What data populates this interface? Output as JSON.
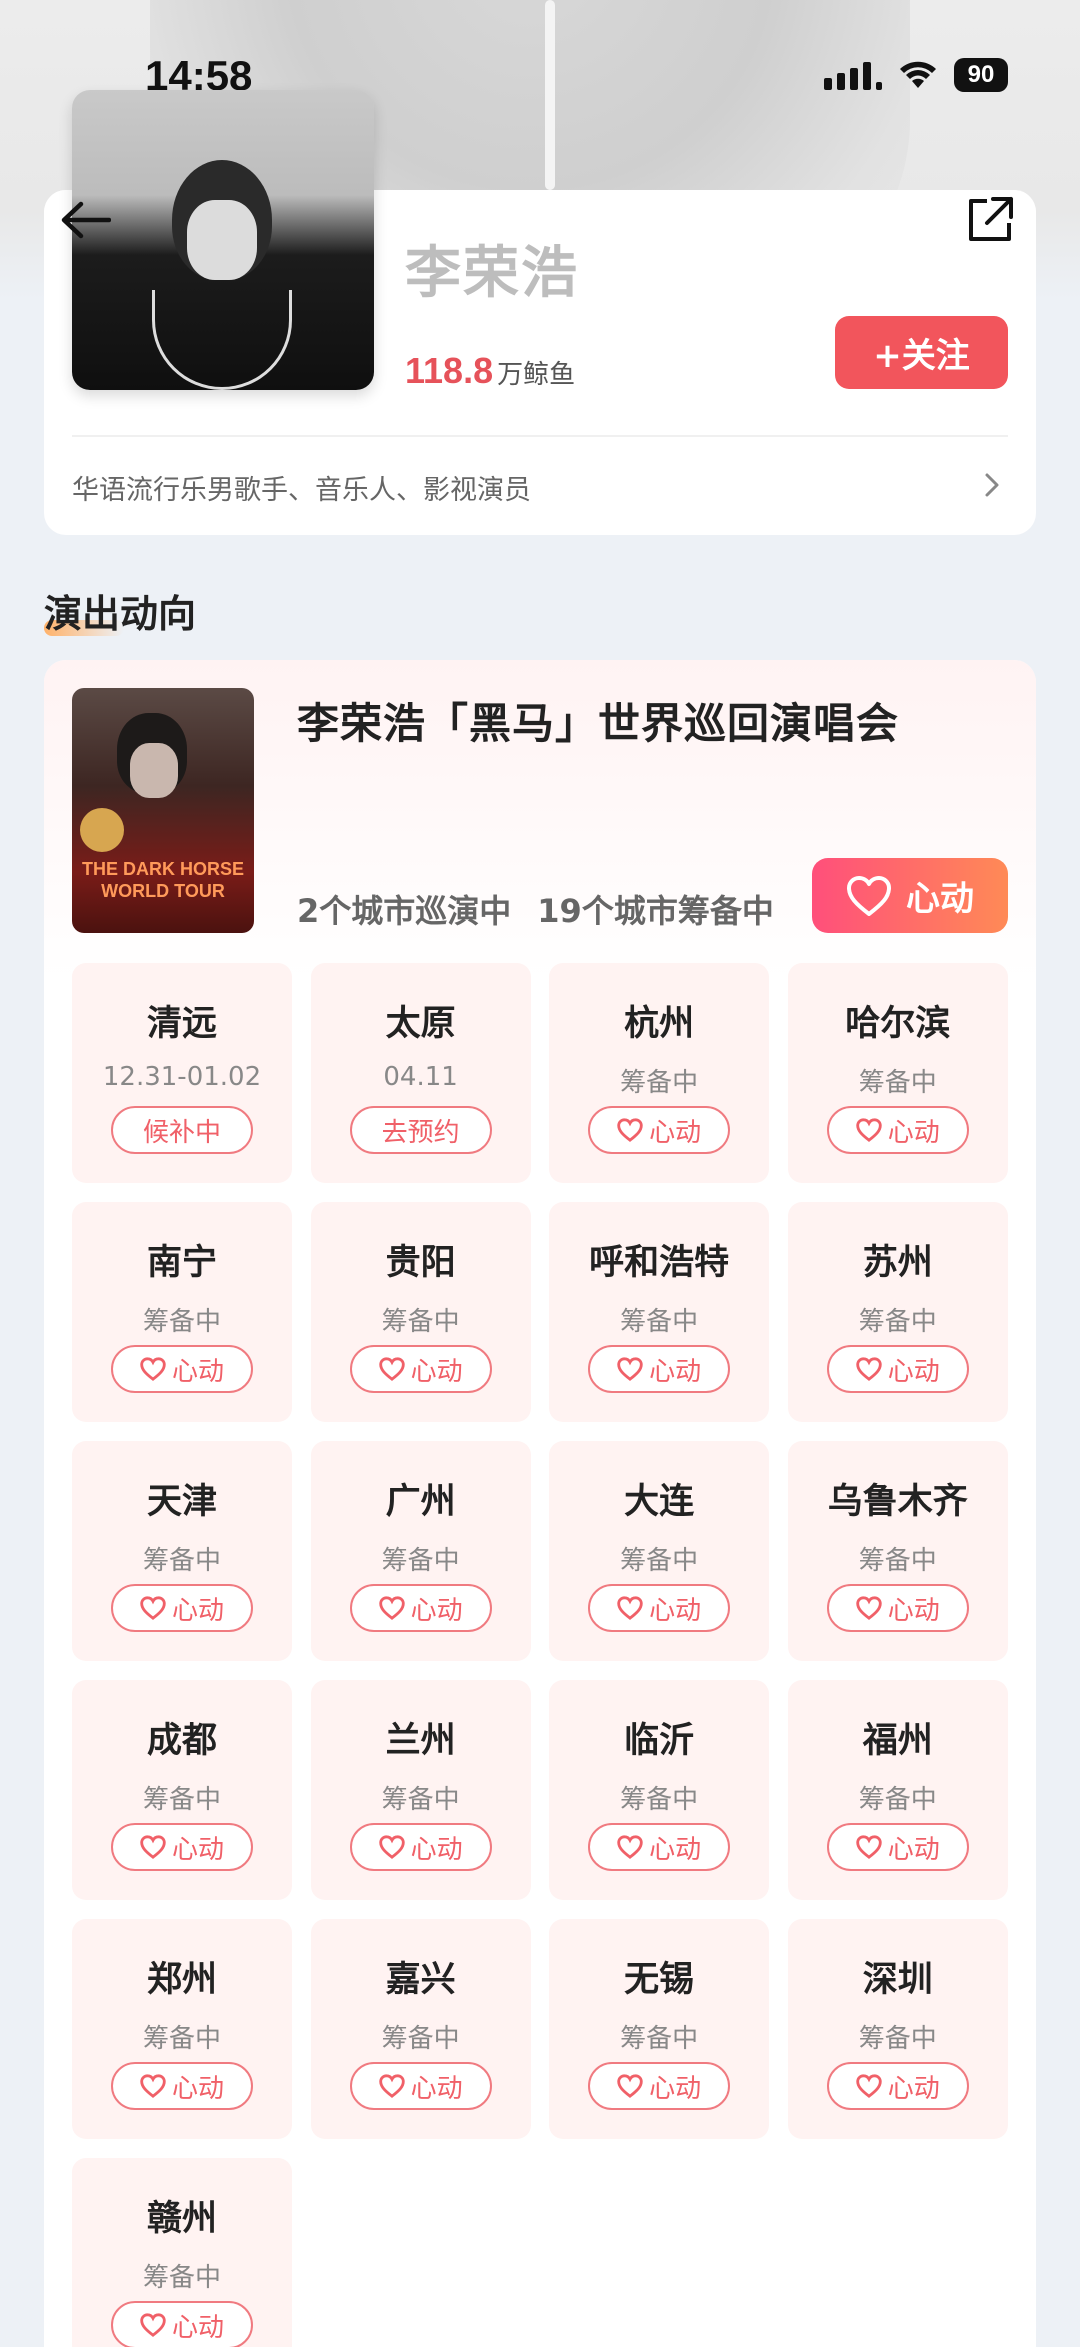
{
  "status_bar": {
    "time": "14:58",
    "battery": "90"
  },
  "artist": {
    "name": "李荣浩",
    "fans_number": "118.8",
    "fans_unit": "万鲸鱼",
    "follow_label": "+关注",
    "bio": "华语流行乐男歌手、音乐人、影视演员"
  },
  "section": {
    "title": "演出动向"
  },
  "show": {
    "title": "李荣浩「黑马」世界巡回演唱会",
    "touring": "2个城市巡演中",
    "preparing": "19个城市筹备中",
    "like_label": "心动",
    "poster_text": "THE DARK HORSE WORLD TOUR"
  },
  "cities": [
    {
      "name": "清远",
      "sub": "12.31-01.02",
      "button": "候补中",
      "heart": false
    },
    {
      "name": "太原",
      "sub": "04.11",
      "button": "去预约",
      "heart": false
    },
    {
      "name": "杭州",
      "sub": "筹备中",
      "button": "心动",
      "heart": true
    },
    {
      "name": "哈尔滨",
      "sub": "筹备中",
      "button": "心动",
      "heart": true
    },
    {
      "name": "南宁",
      "sub": "筹备中",
      "button": "心动",
      "heart": true
    },
    {
      "name": "贵阳",
      "sub": "筹备中",
      "button": "心动",
      "heart": true
    },
    {
      "name": "呼和浩特",
      "sub": "筹备中",
      "button": "心动",
      "heart": true
    },
    {
      "name": "苏州",
      "sub": "筹备中",
      "button": "心动",
      "heart": true
    },
    {
      "name": "天津",
      "sub": "筹备中",
      "button": "心动",
      "heart": true
    },
    {
      "name": "广州",
      "sub": "筹备中",
      "button": "心动",
      "heart": true
    },
    {
      "name": "大连",
      "sub": "筹备中",
      "button": "心动",
      "heart": true
    },
    {
      "name": "乌鲁木齐",
      "sub": "筹备中",
      "button": "心动",
      "heart": true
    },
    {
      "name": "成都",
      "sub": "筹备中",
      "button": "心动",
      "heart": true
    },
    {
      "name": "兰州",
      "sub": "筹备中",
      "button": "心动",
      "heart": true
    },
    {
      "name": "临沂",
      "sub": "筹备中",
      "button": "心动",
      "heart": true
    },
    {
      "name": "福州",
      "sub": "筹备中",
      "button": "心动",
      "heart": true
    },
    {
      "name": "郑州",
      "sub": "筹备中",
      "button": "心动",
      "heart": true
    },
    {
      "name": "嘉兴",
      "sub": "筹备中",
      "button": "心动",
      "heart": true
    },
    {
      "name": "无锡",
      "sub": "筹备中",
      "button": "心动",
      "heart": true
    },
    {
      "name": "深圳",
      "sub": "筹备中",
      "button": "心动",
      "heart": true
    },
    {
      "name": "赣州",
      "sub": "筹备中",
      "button": "心动",
      "heart": true
    }
  ],
  "colors": {
    "accent": "#f2555c",
    "tile_bg": "#fff3f2",
    "fans": "#e6525a"
  }
}
